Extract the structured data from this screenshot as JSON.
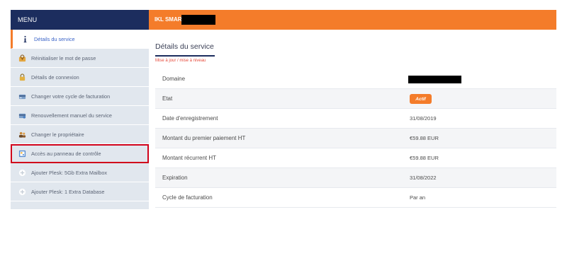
{
  "sidebar": {
    "title": "MENU",
    "items": [
      {
        "label": "Détails du service",
        "icon": "info-icon",
        "state": "active"
      },
      {
        "label": "Réinitialiser le mot de passe",
        "icon": "key-icon",
        "state": ""
      },
      {
        "label": "Détails de connexion",
        "icon": "lock-icon",
        "state": ""
      },
      {
        "label": "Changer votre cycle de facturation",
        "icon": "billing-icon",
        "state": ""
      },
      {
        "label": "Renouvellement manuel du service",
        "icon": "renew-icon",
        "state": ""
      },
      {
        "label": "Changer le propriétaire",
        "icon": "users-icon",
        "state": ""
      },
      {
        "label": "Accès au panneau de contrôle",
        "icon": "control-panel-icon",
        "state": "highlighted"
      },
      {
        "label": "Ajouter Plesk: 5Gb Extra Mailbox",
        "icon": "plus-circle-icon",
        "state": ""
      },
      {
        "label": "Ajouter Plesk: 1 Extra Database",
        "icon": "plus-circle-icon",
        "state": ""
      }
    ]
  },
  "header": {
    "product_name": "IKL SMART"
  },
  "main": {
    "section_title": "Détails du service",
    "section_subtitle": "Mise à jour / mise à niveau",
    "details": [
      {
        "label": "Domaine",
        "value": "",
        "type": "redacted"
      },
      {
        "label": "Etat",
        "value": "Actif",
        "type": "badge"
      },
      {
        "label": "Date d'enregistrement",
        "value": "31/08/2019",
        "type": "text"
      },
      {
        "label": "Montant du premier paiement HT",
        "value": "€59.88 EUR",
        "type": "text"
      },
      {
        "label": "Montant récurrent HT",
        "value": "€59.88 EUR",
        "type": "text"
      },
      {
        "label": "Expiration",
        "value": "31/08/2022",
        "type": "text"
      },
      {
        "label": "Cycle de facturation",
        "value": "Par an",
        "type": "text"
      }
    ]
  },
  "colors": {
    "navy": "#1c2d5e",
    "orange": "#f47c2a",
    "highlight_red": "#d0021b",
    "sidebar_bg": "#e1e7ee"
  }
}
